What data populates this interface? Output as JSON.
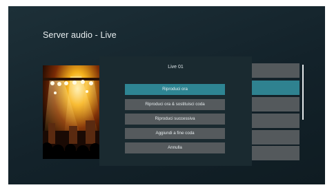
{
  "page": {
    "title": "Server audio - Live"
  },
  "album": {
    "alt": "album-art-concert"
  },
  "list": {
    "items": [
      {
        "state": "normal"
      },
      {
        "state": "selected"
      },
      {
        "state": "normal"
      },
      {
        "state": "normal"
      },
      {
        "state": "normal"
      },
      {
        "state": "normal"
      }
    ]
  },
  "modal": {
    "title": "Live 01",
    "options": [
      {
        "label": "Riproduci ora",
        "selected": true
      },
      {
        "label": "Riproduci ora & sostituisci coda",
        "selected": false
      },
      {
        "label": "Riproduci successiva",
        "selected": false
      },
      {
        "label": "Aggiundi a fine coda",
        "selected": false
      },
      {
        "label": "Annulla",
        "selected": false
      }
    ]
  },
  "colors": {
    "accent": "#2e8593",
    "button": "#555a5d",
    "modal_bg": "#1a2a30",
    "screen_bg": "#18292f"
  }
}
